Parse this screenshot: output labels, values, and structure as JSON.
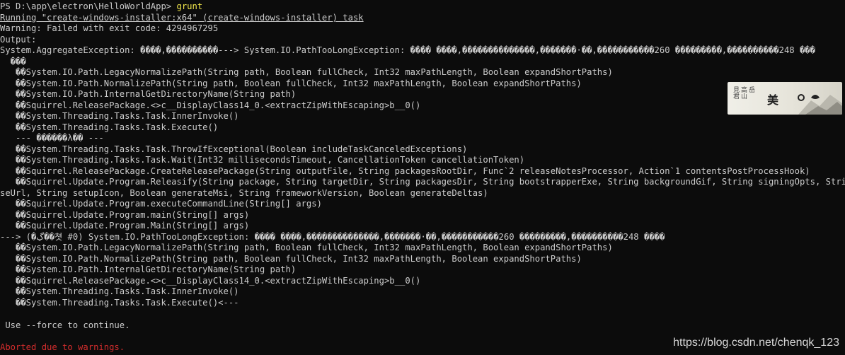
{
  "terminal": {
    "prompt": "PS D:\\app\\electron\\HelloWorldApp> ",
    "command": "grunt",
    "running_task": "Running \"create-windows-installer:x64\" (create-windows-installer) task",
    "warning": "Warning: Failed with exit code: 4294967295",
    "output_label": "Output:",
    "lines": [
      "System.AggregateException: ����,����������---> System.IO.PathTooLongException: ���� ����,��������������,�������·��,�����������260 ���������,����������248 ���",
      "  ���",
      "   ��System.IO.Path.LegacyNormalizePath(String path, Boolean fullCheck, Int32 maxPathLength, Boolean expandShortPaths)",
      "   ��System.IO.Path.NormalizePath(String path, Boolean fullCheck, Int32 maxPathLength, Boolean expandShortPaths)",
      "   ��System.IO.Path.InternalGetDirectoryName(String path)",
      "   ��Squirrel.ReleasePackage.<>c__DisplayClass14_0.<extractZipWithEscaping>b__0()",
      "   ��System.Threading.Tasks.Task.InnerInvoke()",
      "   ��System.Threading.Tasks.Task.Execute()",
      "   --- ������λ�� ---",
      "   ��System.Threading.Tasks.Task.ThrowIfExceptional(Boolean includeTaskCanceledExceptions)",
      "   ��System.Threading.Tasks.Task.Wait(Int32 millisecondsTimeout, CancellationToken cancellationToken)",
      "   ��Squirrel.ReleasePackage.CreateReleasePackage(String outputFile, String packagesRootDir, Func`2 releaseNotesProcessor, Action`1 contentsPostProcessHook)",
      "   ��Squirrel.Update.Program.Releasify(String package, String targetDir, String packagesDir, String bootstrapperExe, String backgroundGif, String signingOpts, String ba",
      "seUrl, String setupIcon, Boolean generateMsi, String frameworkVersion, Boolean generateDeltas)",
      "   ��Squirrel.Update.Program.executeCommandLine(String[] args)",
      "   ��Squirrel.Update.Program.main(String[] args)",
      "   ��Squirrel.Update.Program.Main(String[] args)",
      "---> (�ڲ��쳣 #0) System.IO.PathTooLongException: ���� ����,��������������,�������·��,�����������260 ���������,����������248 ����",
      "   ��System.IO.Path.LegacyNormalizePath(String path, Boolean fullCheck, Int32 maxPathLength, Boolean expandShortPaths)",
      "   ��System.IO.Path.NormalizePath(String path, Boolean fullCheck, Int32 maxPathLength, Boolean expandShortPaths)",
      "   ��System.IO.Path.InternalGetDirectoryName(String path)",
      "   ��Squirrel.ReleasePackage.<>c__DisplayClass14_0.<extractZipWithEscaping>b__0()",
      "   ��System.Threading.Tasks.Task.InnerInvoke()",
      "   ��System.Threading.Tasks.Task.Execute()<---"
    ],
    "force_hint": " Use --force to continue.",
    "aborted": "Aborted due to warnings."
  },
  "watermark": "https://blog.csdn.net/chenqk_123",
  "banner": {
    "left_text_a": "見君",
    "left_text_b": "高山",
    "left_text_c": "岳",
    "center_text": "美",
    "colors": {
      "ink": "#222222",
      "paper": "#ecebe3"
    }
  },
  "colors": {
    "background": "#0c0c0c",
    "text": "#cccccc",
    "warning_yellow": "#f2e74b",
    "error_red": "#d42d2d"
  }
}
